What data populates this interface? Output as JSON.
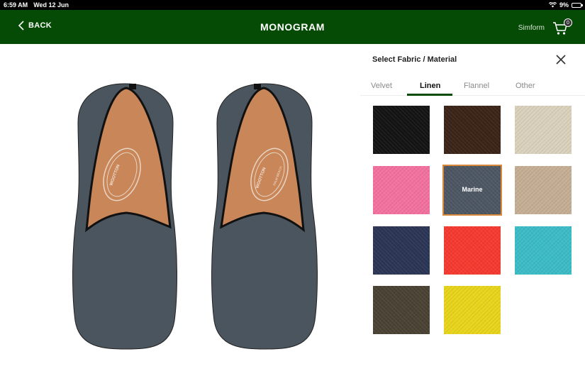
{
  "status": {
    "time": "6:59 AM",
    "date": "Wed 12 Jun",
    "battery": "9%",
    "battery_level": 0.09
  },
  "header": {
    "back_label": "BACK",
    "title": "MONOGRAM",
    "brand": "Simform",
    "cart_count": "0"
  },
  "preview": {
    "shoe_color": "#4d5760",
    "lining_color": "#c98658",
    "insole_text": "WOOTTON",
    "insole_subtext": "PALM BEACH"
  },
  "panel": {
    "title": "Select Fabric / Material",
    "tabs": [
      {
        "label": "Velvet",
        "active": false
      },
      {
        "label": "Linen",
        "active": true
      },
      {
        "label": "Flannel",
        "active": false
      },
      {
        "label": "Other",
        "active": false
      }
    ],
    "accent": "#054b05",
    "swatches": [
      {
        "color": "#141414",
        "label": "",
        "selected": false
      },
      {
        "color": "#3b2418",
        "label": "",
        "selected": false
      },
      {
        "color": "#d9d1bc",
        "label": "",
        "selected": false
      },
      {
        "color": "#f2719e",
        "label": "",
        "selected": false
      },
      {
        "color": "#4d5763",
        "label": "Marine",
        "selected": true
      },
      {
        "color": "#c4ae94",
        "label": "",
        "selected": false
      },
      {
        "color": "#2b3556",
        "label": "",
        "selected": false
      },
      {
        "color": "#f53a30",
        "label": "",
        "selected": false
      },
      {
        "color": "#3cbcc5",
        "label": "",
        "selected": false
      },
      {
        "color": "#4a4233",
        "label": "",
        "selected": false
      },
      {
        "color": "#e7d41b",
        "label": "",
        "selected": false
      }
    ]
  }
}
